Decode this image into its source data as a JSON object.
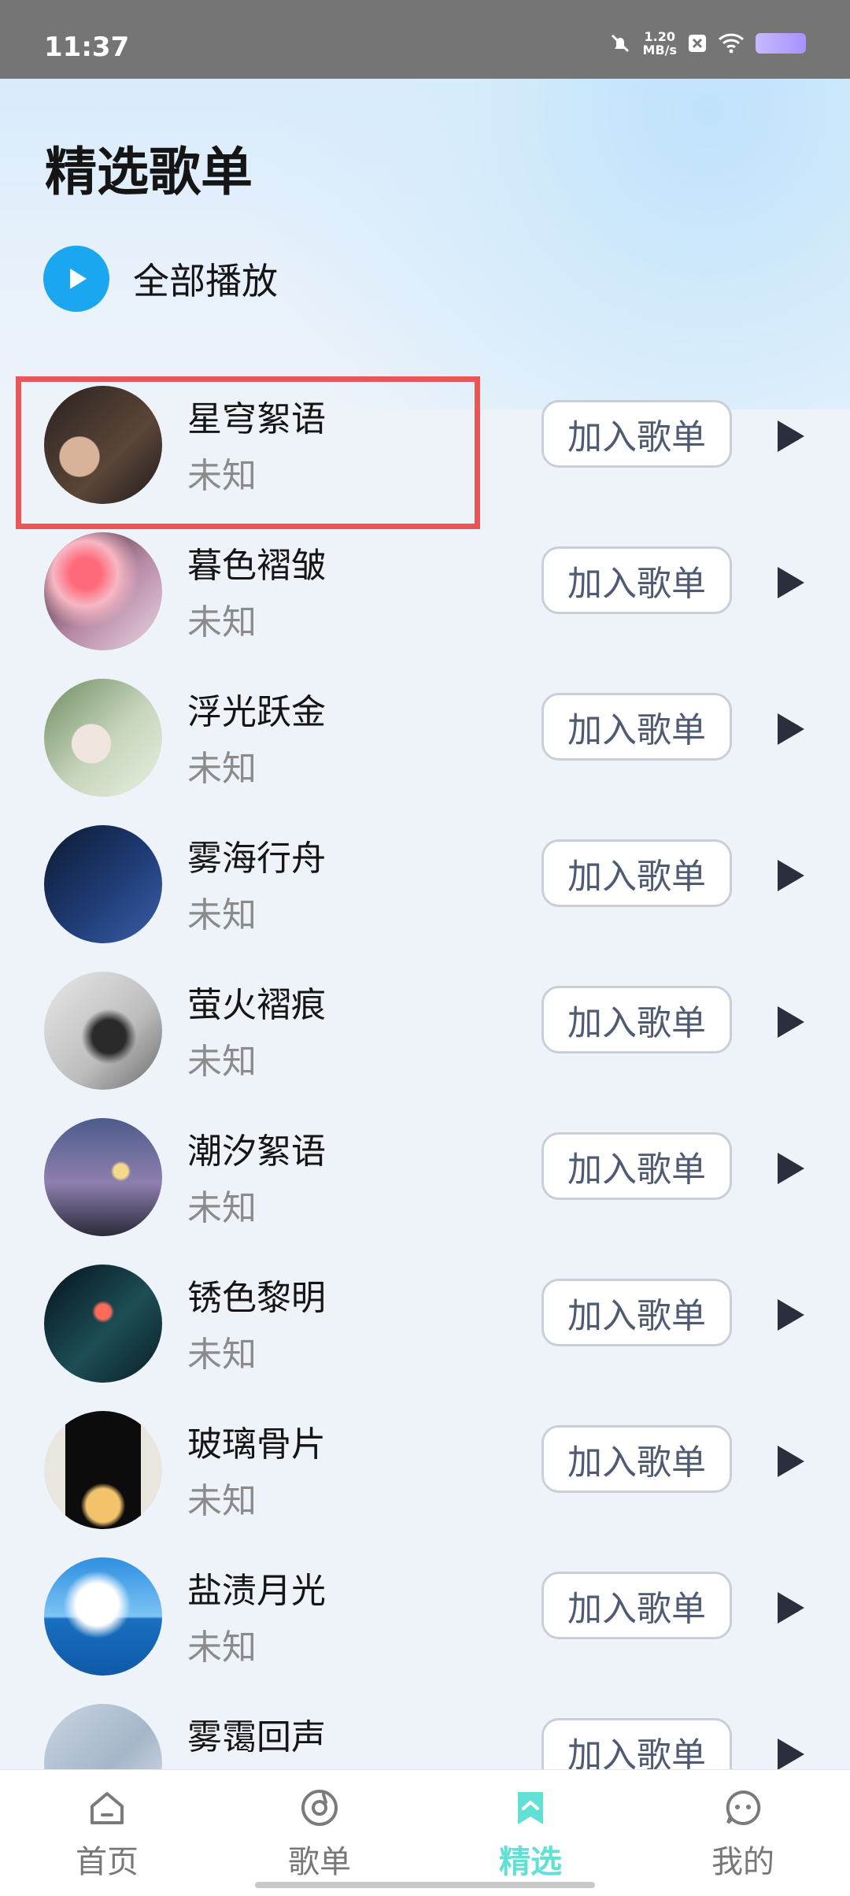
{
  "status_bar": {
    "time": "11:37",
    "network_speed": "1.20\nMB/s"
  },
  "page": {
    "title": "精选歌单",
    "play_all_label": "全部播放"
  },
  "songs": [
    {
      "title": "星穹絮语",
      "artist": "未知",
      "add_label": "加入歌单"
    },
    {
      "title": "暮色褶皱",
      "artist": "未知",
      "add_label": "加入歌单"
    },
    {
      "title": "浮光跃金",
      "artist": "未知",
      "add_label": "加入歌单"
    },
    {
      "title": "雾海行舟",
      "artist": "未知",
      "add_label": "加入歌单"
    },
    {
      "title": "萤火褶痕",
      "artist": "未知",
      "add_label": "加入歌单"
    },
    {
      "title": "潮汐絮语",
      "artist": "未知",
      "add_label": "加入歌单"
    },
    {
      "title": "锈色黎明",
      "artist": "未知",
      "add_label": "加入歌单"
    },
    {
      "title": "玻璃骨片",
      "artist": "未知",
      "add_label": "加入歌单"
    },
    {
      "title": "盐渍月光",
      "artist": "未知",
      "add_label": "加入歌单"
    },
    {
      "title": "雾霭回声",
      "artist": "",
      "add_label": "加入歌单"
    }
  ],
  "tabs": [
    {
      "label": "首页",
      "icon": "home-icon"
    },
    {
      "label": "歌单",
      "icon": "disc-icon"
    },
    {
      "label": "精选",
      "icon": "bookmark-icon"
    },
    {
      "label": "我的",
      "icon": "chat-face-icon"
    }
  ],
  "colors": {
    "accent": "#1aa7f0",
    "active_tab": "#63e0d5",
    "highlight": "#e85656"
  }
}
